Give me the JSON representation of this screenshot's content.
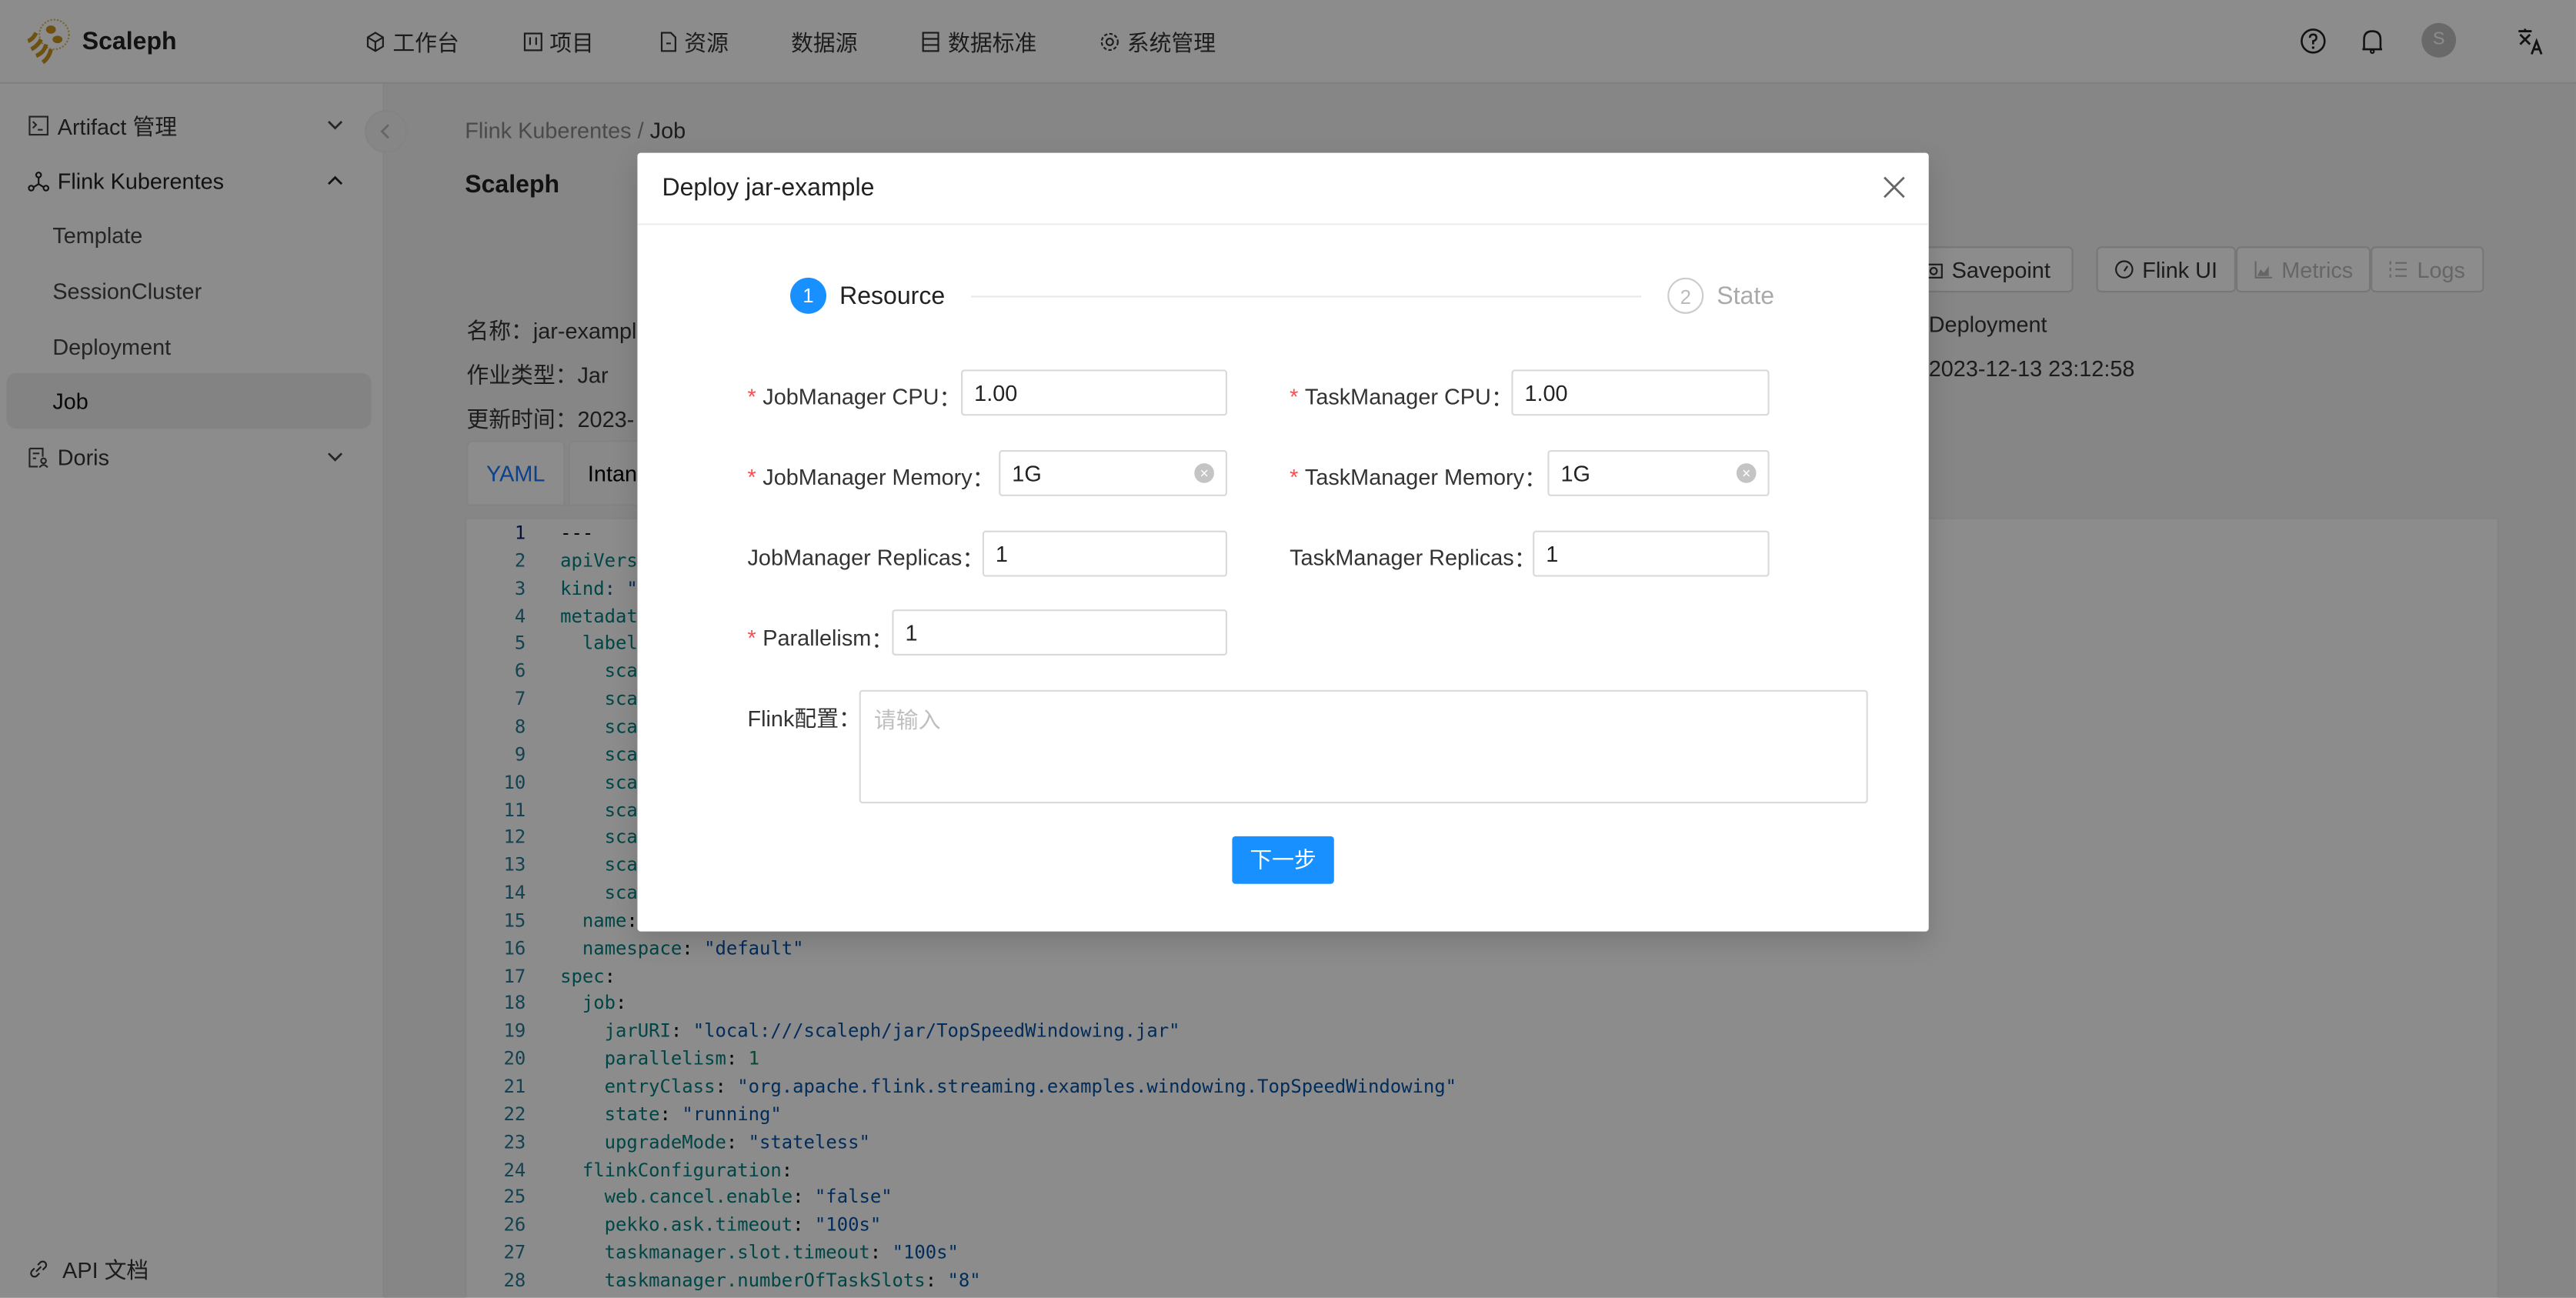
{
  "app": {
    "name": "Scaleph"
  },
  "header": {
    "nav": [
      {
        "label": "工作台",
        "icon": "cube-icon"
      },
      {
        "label": "项目",
        "icon": "project-icon"
      },
      {
        "label": "资源",
        "icon": "file-icon"
      },
      {
        "label": "数据源",
        "icon": ""
      },
      {
        "label": "数据标准",
        "icon": "list-icon"
      },
      {
        "label": "系统管理",
        "icon": "gear-icon"
      }
    ],
    "avatar_initial": "S"
  },
  "sidebar": {
    "items": [
      {
        "label": "Artifact 管理",
        "icon": "terminal-icon",
        "expanded": false
      },
      {
        "label": "Flink Kuberentes",
        "icon": "cluster-icon",
        "expanded": true
      },
      {
        "label": "Doris",
        "icon": "doc-user-icon",
        "expanded": false
      }
    ],
    "sub_items": [
      "Template",
      "SessionCluster",
      "Deployment",
      "Job"
    ],
    "active_sub": "Job",
    "footer_link": "API 文档"
  },
  "main": {
    "breadcrumb": [
      "Flink Kuberentes",
      "Job"
    ],
    "title": "Scaleph",
    "info": {
      "name_label": "名称：",
      "name_value": "jar-exampl",
      "type_label": "作业类型：",
      "type_value": "Jar",
      "updated_label": "更新时间：",
      "updated_value": "2023-",
      "right_col1": "Deployment",
      "right_col2": "2023-12-13 23:12:58"
    },
    "actions": [
      {
        "label": "Savepoint",
        "disabled": false
      },
      {
        "label": "Flink UI",
        "disabled": false
      },
      {
        "label": "Metrics",
        "disabled": true
      },
      {
        "label": "Logs",
        "disabled": true
      }
    ],
    "tabs": [
      {
        "label": "YAML",
        "active": true
      },
      {
        "label": "Intanc",
        "active": false
      }
    ],
    "code_lines": [
      [
        {
          "t": "---",
          "c": "p"
        }
      ],
      [
        {
          "t": "apiVers",
          "c": "k"
        }
      ],
      [
        {
          "t": "kind",
          "c": "k"
        },
        {
          "t": ": \"",
          "c": "s"
        }
      ],
      [
        {
          "t": "metadat",
          "c": "k"
        }
      ],
      [
        {
          "t": "  label",
          "c": "k"
        }
      ],
      [
        {
          "t": "    sca",
          "c": "k"
        }
      ],
      [
        {
          "t": "    sca",
          "c": "k"
        }
      ],
      [
        {
          "t": "    sca",
          "c": "k"
        }
      ],
      [
        {
          "t": "    sca",
          "c": "k"
        }
      ],
      [
        {
          "t": "    sca",
          "c": "k"
        }
      ],
      [
        {
          "t": "    sca",
          "c": "k"
        }
      ],
      [
        {
          "t": "    sca",
          "c": "k"
        }
      ],
      [
        {
          "t": "    sca",
          "c": "k"
        }
      ],
      [
        {
          "t": "    sca",
          "c": "k"
        }
      ],
      [
        {
          "t": "  name",
          "c": "k"
        },
        {
          "t": ":",
          "c": "p"
        }
      ],
      [
        {
          "t": "  namespace",
          "c": "k"
        },
        {
          "t": ": ",
          "c": "p"
        },
        {
          "t": "\"default\"",
          "c": "s"
        }
      ],
      [
        {
          "t": "spec",
          "c": "k"
        },
        {
          "t": ":",
          "c": "p"
        }
      ],
      [
        {
          "t": "  job",
          "c": "k"
        },
        {
          "t": ":",
          "c": "p"
        }
      ],
      [
        {
          "t": "    jarURI",
          "c": "k"
        },
        {
          "t": ": ",
          "c": "p"
        },
        {
          "t": "\"local:///scaleph/jar/TopSpeedWindowing.jar\"",
          "c": "s"
        }
      ],
      [
        {
          "t": "    parallelism",
          "c": "k"
        },
        {
          "t": ": ",
          "c": "p"
        },
        {
          "t": "1",
          "c": "n"
        }
      ],
      [
        {
          "t": "    entryClass",
          "c": "k"
        },
        {
          "t": ": ",
          "c": "p"
        },
        {
          "t": "\"org.apache.flink.streaming.examples.windowing.TopSpeedWindowing\"",
          "c": "s"
        }
      ],
      [
        {
          "t": "    state",
          "c": "k"
        },
        {
          "t": ": ",
          "c": "p"
        },
        {
          "t": "\"running\"",
          "c": "s"
        }
      ],
      [
        {
          "t": "    upgradeMode",
          "c": "k"
        },
        {
          "t": ": ",
          "c": "p"
        },
        {
          "t": "\"stateless\"",
          "c": "s"
        }
      ],
      [
        {
          "t": "  flinkConfiguration",
          "c": "k"
        },
        {
          "t": ":",
          "c": "p"
        }
      ],
      [
        {
          "t": "    web.cancel.enable",
          "c": "k"
        },
        {
          "t": ": ",
          "c": "p"
        },
        {
          "t": "\"false\"",
          "c": "s"
        }
      ],
      [
        {
          "t": "    pekko.ask.timeout",
          "c": "k"
        },
        {
          "t": ": ",
          "c": "p"
        },
        {
          "t": "\"100s\"",
          "c": "s"
        }
      ],
      [
        {
          "t": "    taskmanager.slot.timeout",
          "c": "k"
        },
        {
          "t": ": ",
          "c": "p"
        },
        {
          "t": "\"100s\"",
          "c": "s"
        }
      ],
      [
        {
          "t": "    taskmanager.numberOfTaskSlots",
          "c": "k"
        },
        {
          "t": ": ",
          "c": "p"
        },
        {
          "t": "\"8\"",
          "c": "s"
        }
      ]
    ]
  },
  "modal": {
    "title": "Deploy jar-example",
    "steps": [
      {
        "num": "1",
        "label": "Resource",
        "active": true
      },
      {
        "num": "2",
        "label": "State",
        "active": false
      }
    ],
    "fields": {
      "jm_cpu": {
        "label": "JobManager CPU",
        "value": "1.00",
        "required": true
      },
      "tm_cpu": {
        "label": "TaskManager CPU",
        "value": "1.00",
        "required": true
      },
      "jm_mem": {
        "label": "JobManager Memory",
        "value": "1G",
        "required": true
      },
      "tm_mem": {
        "label": "TaskManager Memory",
        "value": "1G",
        "required": true
      },
      "jm_rep": {
        "label": "JobManager Replicas",
        "value": "1",
        "required": false
      },
      "tm_rep": {
        "label": "TaskManager Replicas",
        "value": "1",
        "required": false
      },
      "parallelism": {
        "label": "Parallelism",
        "value": "1",
        "required": true
      },
      "flink_conf": {
        "label": "Flink配置",
        "placeholder": "请输入",
        "value": ""
      }
    },
    "colon": "：",
    "next_label": "下一步"
  },
  "colors": {
    "primary": "#1890ff",
    "required": "#ff4d4f",
    "logo": "#c9941f"
  }
}
